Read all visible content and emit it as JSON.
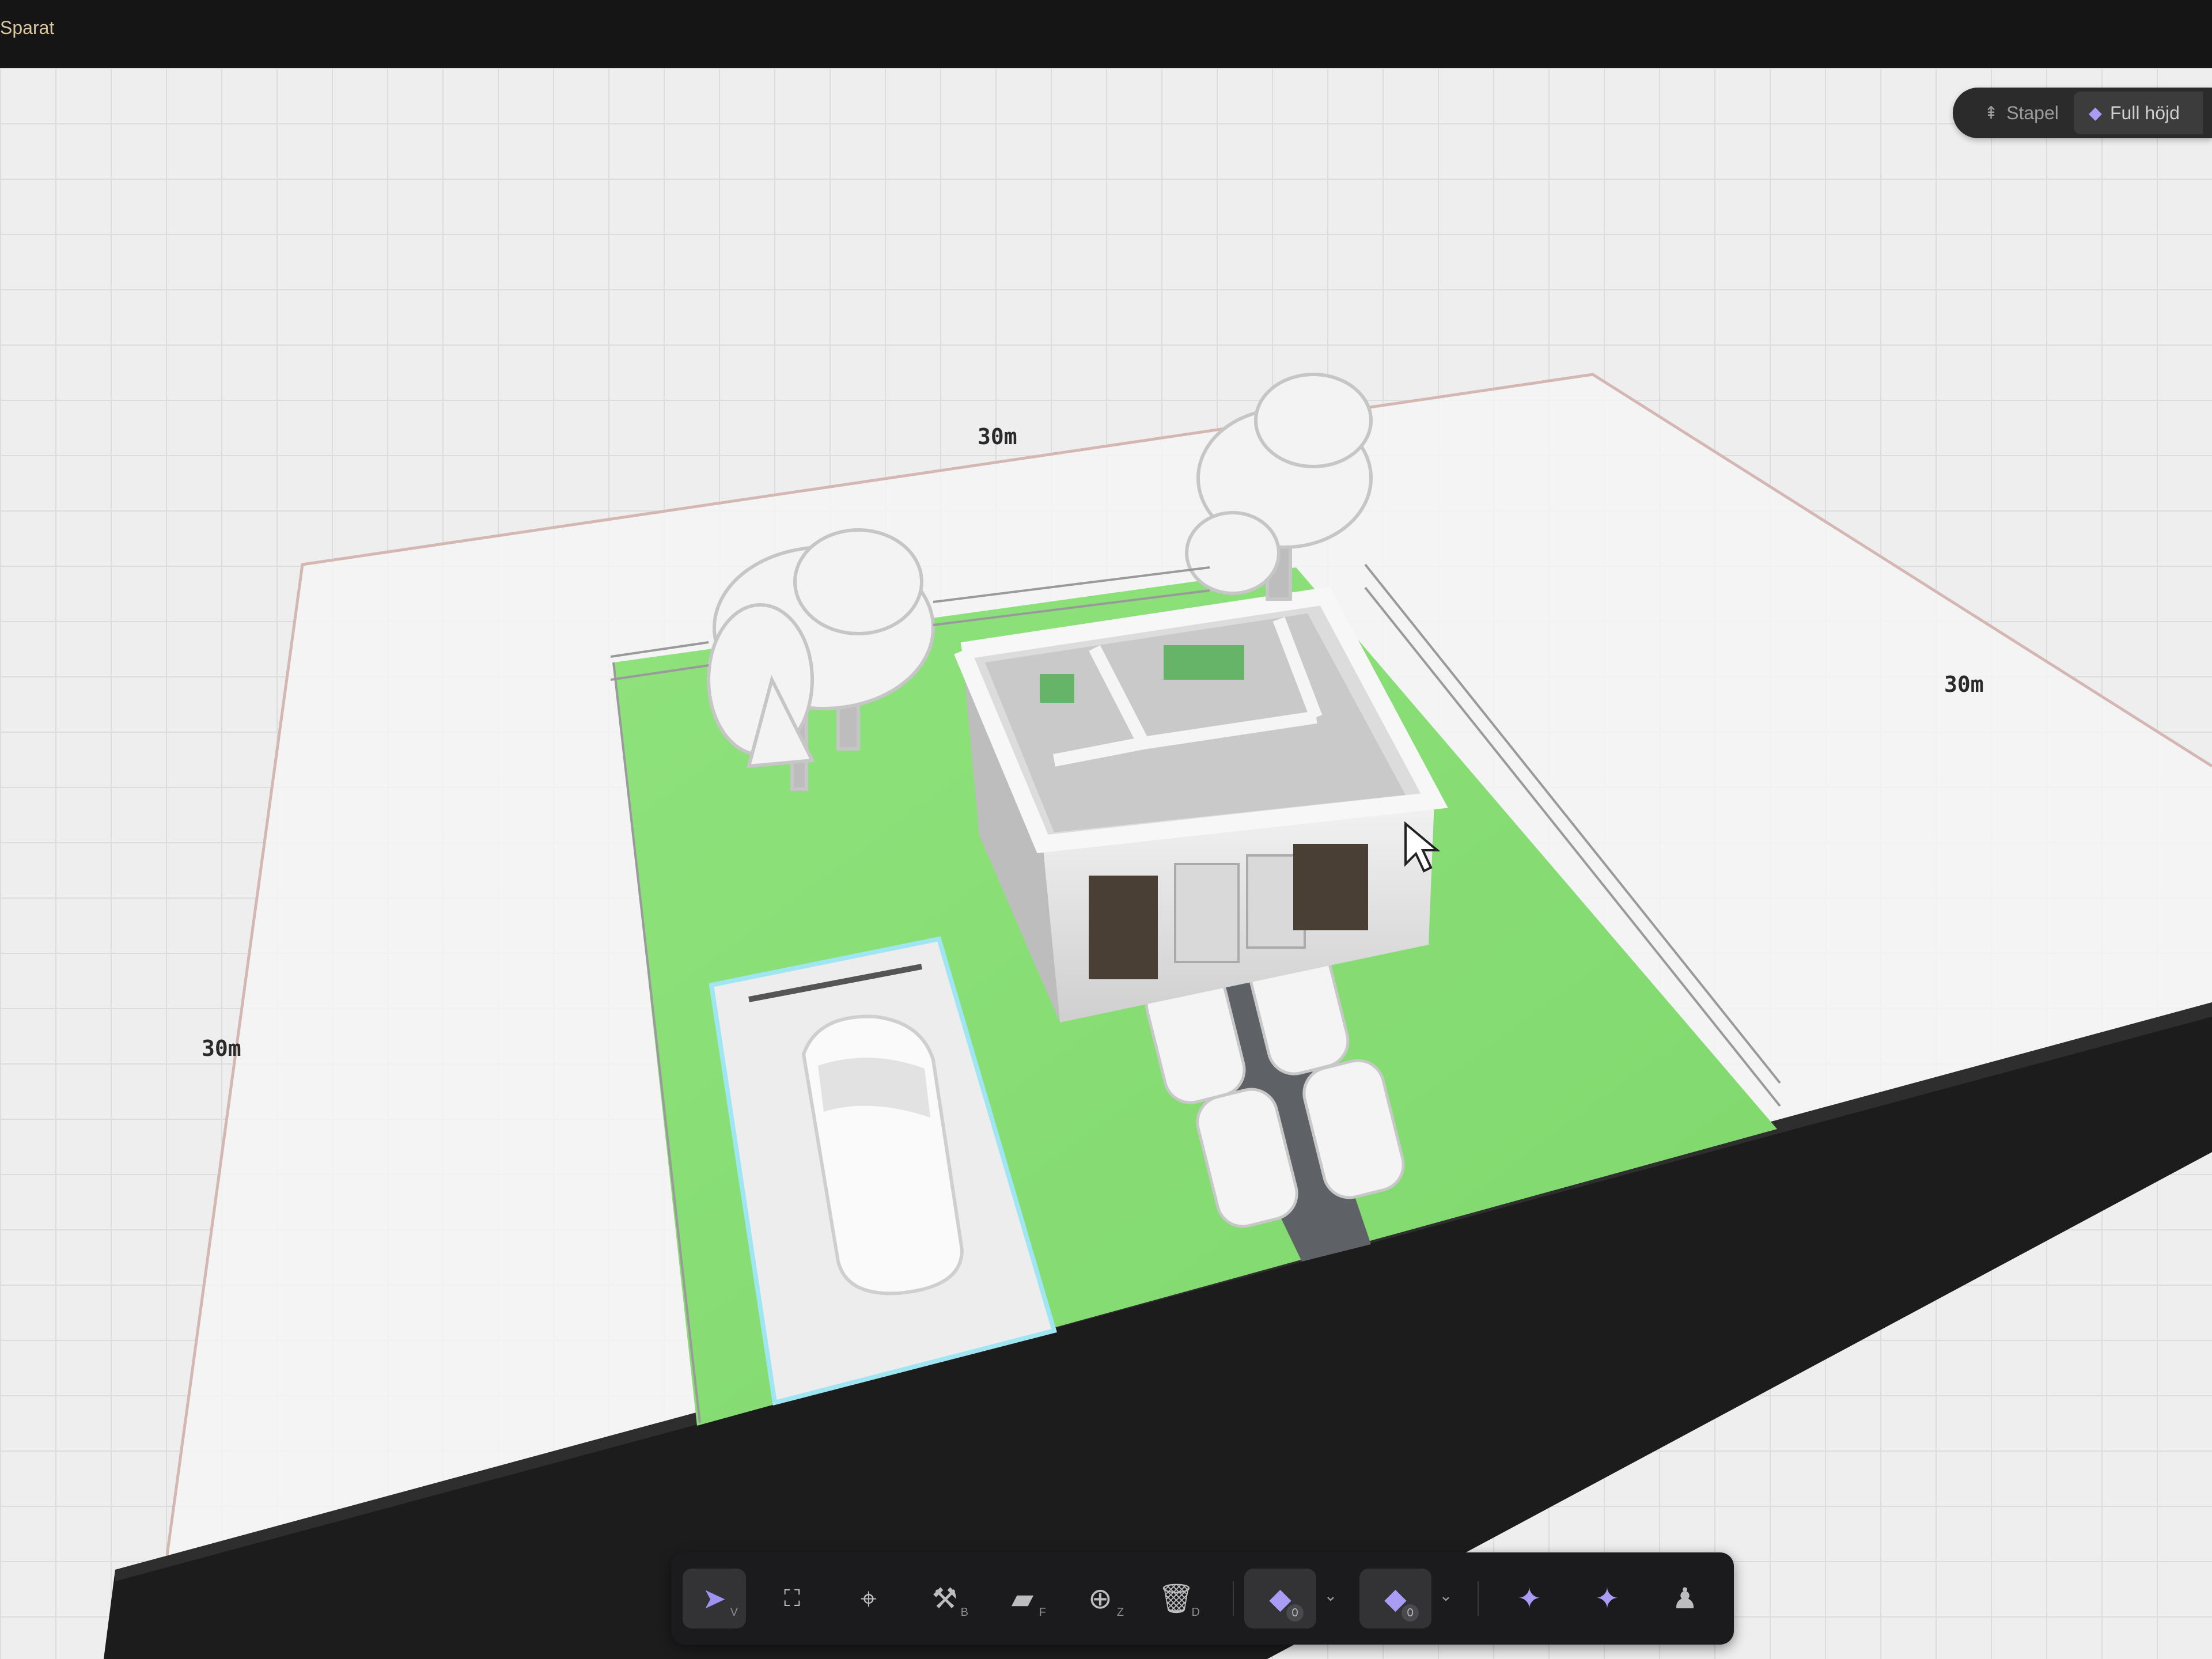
{
  "app": {
    "save_status": "Sparat"
  },
  "view_toggle": {
    "options": [
      {
        "label": "Stapel",
        "icon": "stack-icon",
        "active": false
      },
      {
        "label": "Full höjd",
        "icon": "full-height-icon",
        "active": true
      }
    ]
  },
  "scene": {
    "dimensions": {
      "top": "30m",
      "right": "30m",
      "left": "30m"
    },
    "colors": {
      "lawn": "#8ee07a",
      "road": "#1f1f1f",
      "grid": "#eeeeee",
      "plot": "#f3f3f3"
    }
  },
  "toolbar": {
    "tools": [
      {
        "name": "select-tool",
        "icon": "cursor-arrow-icon",
        "key": "V",
        "active": true
      },
      {
        "name": "area-tool",
        "icon": "area-select-icon",
        "key": ""
      },
      {
        "name": "pin-tool",
        "icon": "location-pin-icon",
        "key": ""
      },
      {
        "name": "build-tool",
        "icon": "hammer-wrench-icon",
        "key": "B"
      },
      {
        "name": "furniture-tool",
        "icon": "sofa-icon",
        "key": "F"
      },
      {
        "name": "zone-tool",
        "icon": "zone-icon",
        "key": "Z"
      },
      {
        "name": "delete-tool",
        "icon": "trash-icon",
        "key": "D"
      }
    ],
    "layer_groups": [
      {
        "name": "floor-layer",
        "icon": "layer-icon",
        "badge": "0"
      },
      {
        "name": "roof-layer",
        "icon": "layer-icon",
        "badge": "0"
      }
    ],
    "camera": [
      {
        "name": "orbit-horizontal",
        "icon": "orbit-icon"
      },
      {
        "name": "orbit-vertical",
        "icon": "orbit-icon"
      },
      {
        "name": "person-view",
        "icon": "person-icon"
      }
    ]
  }
}
